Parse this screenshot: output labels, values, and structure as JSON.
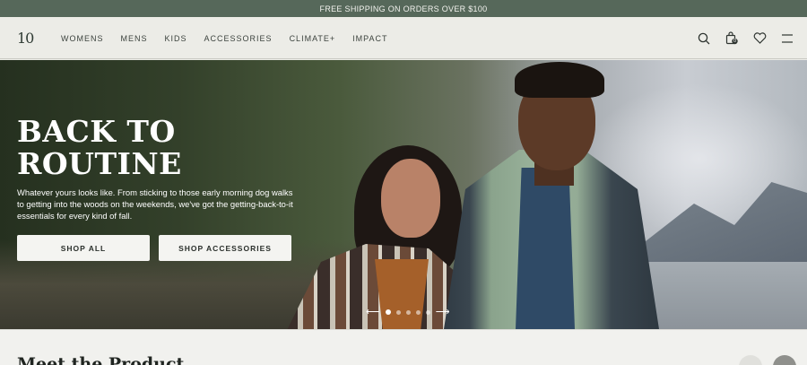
{
  "promo": {
    "text": "FREE SHIPPING ON ORDERS OVER $100"
  },
  "header": {
    "logo": "10",
    "nav": [
      "WOMENS",
      "MENS",
      "KIDS",
      "ACCESSORIES",
      "CLIMATE+",
      "IMPACT"
    ],
    "cart_count": "0"
  },
  "hero": {
    "title_line1": "BACK TO",
    "title_line2": "ROUTINE",
    "description": "Whatever yours looks like. From sticking to those early morning dog walks to getting into the woods on the weekends, we've got the getting-back-to-it essentials for every kind of fall.",
    "btn_shop_all": "SHOP ALL",
    "btn_shop_accessories": "SHOP ACCESSORIES",
    "prev_arrow": "⟵",
    "next_arrow": "⟶",
    "slides": 5,
    "active_slide": 1
  },
  "section": {
    "title": "Meet the Product",
    "prev": "«",
    "next": "»"
  },
  "colors": {
    "promo_bg": "#56685a",
    "page_bg": "#ecece7",
    "button_bg": "#f4f4f1"
  },
  "icons": [
    "search-icon",
    "bag-icon",
    "heart-icon",
    "menu-icon"
  ]
}
